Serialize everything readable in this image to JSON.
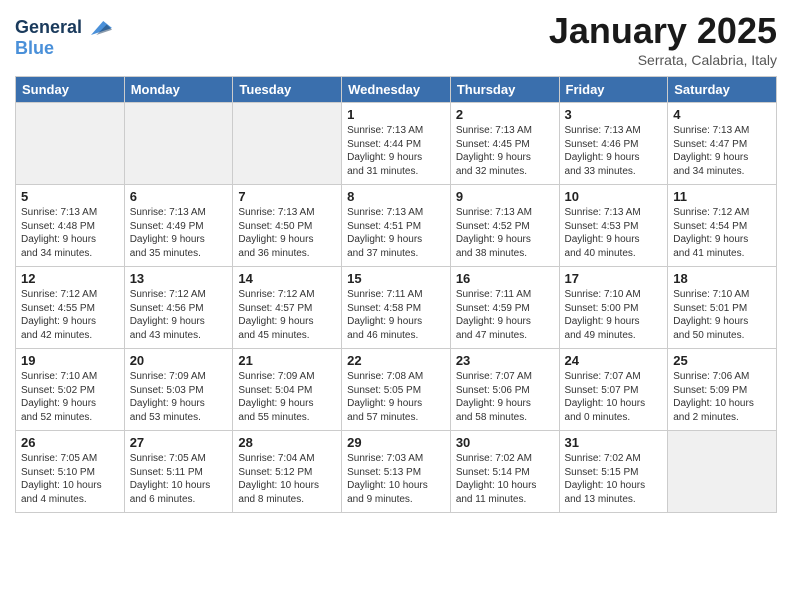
{
  "header": {
    "logo_line1": "General",
    "logo_line2": "Blue",
    "title": "January 2025",
    "location": "Serrata, Calabria, Italy"
  },
  "days_of_week": [
    "Sunday",
    "Monday",
    "Tuesday",
    "Wednesday",
    "Thursday",
    "Friday",
    "Saturday"
  ],
  "weeks": [
    [
      {
        "day": "",
        "detail": ""
      },
      {
        "day": "",
        "detail": ""
      },
      {
        "day": "",
        "detail": ""
      },
      {
        "day": "1",
        "detail": "Sunrise: 7:13 AM\nSunset: 4:44 PM\nDaylight: 9 hours\nand 31 minutes."
      },
      {
        "day": "2",
        "detail": "Sunrise: 7:13 AM\nSunset: 4:45 PM\nDaylight: 9 hours\nand 32 minutes."
      },
      {
        "day": "3",
        "detail": "Sunrise: 7:13 AM\nSunset: 4:46 PM\nDaylight: 9 hours\nand 33 minutes."
      },
      {
        "day": "4",
        "detail": "Sunrise: 7:13 AM\nSunset: 4:47 PM\nDaylight: 9 hours\nand 34 minutes."
      }
    ],
    [
      {
        "day": "5",
        "detail": "Sunrise: 7:13 AM\nSunset: 4:48 PM\nDaylight: 9 hours\nand 34 minutes."
      },
      {
        "day": "6",
        "detail": "Sunrise: 7:13 AM\nSunset: 4:49 PM\nDaylight: 9 hours\nand 35 minutes."
      },
      {
        "day": "7",
        "detail": "Sunrise: 7:13 AM\nSunset: 4:50 PM\nDaylight: 9 hours\nand 36 minutes."
      },
      {
        "day": "8",
        "detail": "Sunrise: 7:13 AM\nSunset: 4:51 PM\nDaylight: 9 hours\nand 37 minutes."
      },
      {
        "day": "9",
        "detail": "Sunrise: 7:13 AM\nSunset: 4:52 PM\nDaylight: 9 hours\nand 38 minutes."
      },
      {
        "day": "10",
        "detail": "Sunrise: 7:13 AM\nSunset: 4:53 PM\nDaylight: 9 hours\nand 40 minutes."
      },
      {
        "day": "11",
        "detail": "Sunrise: 7:12 AM\nSunset: 4:54 PM\nDaylight: 9 hours\nand 41 minutes."
      }
    ],
    [
      {
        "day": "12",
        "detail": "Sunrise: 7:12 AM\nSunset: 4:55 PM\nDaylight: 9 hours\nand 42 minutes."
      },
      {
        "day": "13",
        "detail": "Sunrise: 7:12 AM\nSunset: 4:56 PM\nDaylight: 9 hours\nand 43 minutes."
      },
      {
        "day": "14",
        "detail": "Sunrise: 7:12 AM\nSunset: 4:57 PM\nDaylight: 9 hours\nand 45 minutes."
      },
      {
        "day": "15",
        "detail": "Sunrise: 7:11 AM\nSunset: 4:58 PM\nDaylight: 9 hours\nand 46 minutes."
      },
      {
        "day": "16",
        "detail": "Sunrise: 7:11 AM\nSunset: 4:59 PM\nDaylight: 9 hours\nand 47 minutes."
      },
      {
        "day": "17",
        "detail": "Sunrise: 7:10 AM\nSunset: 5:00 PM\nDaylight: 9 hours\nand 49 minutes."
      },
      {
        "day": "18",
        "detail": "Sunrise: 7:10 AM\nSunset: 5:01 PM\nDaylight: 9 hours\nand 50 minutes."
      }
    ],
    [
      {
        "day": "19",
        "detail": "Sunrise: 7:10 AM\nSunset: 5:02 PM\nDaylight: 9 hours\nand 52 minutes."
      },
      {
        "day": "20",
        "detail": "Sunrise: 7:09 AM\nSunset: 5:03 PM\nDaylight: 9 hours\nand 53 minutes."
      },
      {
        "day": "21",
        "detail": "Sunrise: 7:09 AM\nSunset: 5:04 PM\nDaylight: 9 hours\nand 55 minutes."
      },
      {
        "day": "22",
        "detail": "Sunrise: 7:08 AM\nSunset: 5:05 PM\nDaylight: 9 hours\nand 57 minutes."
      },
      {
        "day": "23",
        "detail": "Sunrise: 7:07 AM\nSunset: 5:06 PM\nDaylight: 9 hours\nand 58 minutes."
      },
      {
        "day": "24",
        "detail": "Sunrise: 7:07 AM\nSunset: 5:07 PM\nDaylight: 10 hours\nand 0 minutes."
      },
      {
        "day": "25",
        "detail": "Sunrise: 7:06 AM\nSunset: 5:09 PM\nDaylight: 10 hours\nand 2 minutes."
      }
    ],
    [
      {
        "day": "26",
        "detail": "Sunrise: 7:05 AM\nSunset: 5:10 PM\nDaylight: 10 hours\nand 4 minutes."
      },
      {
        "day": "27",
        "detail": "Sunrise: 7:05 AM\nSunset: 5:11 PM\nDaylight: 10 hours\nand 6 minutes."
      },
      {
        "day": "28",
        "detail": "Sunrise: 7:04 AM\nSunset: 5:12 PM\nDaylight: 10 hours\nand 8 minutes."
      },
      {
        "day": "29",
        "detail": "Sunrise: 7:03 AM\nSunset: 5:13 PM\nDaylight: 10 hours\nand 9 minutes."
      },
      {
        "day": "30",
        "detail": "Sunrise: 7:02 AM\nSunset: 5:14 PM\nDaylight: 10 hours\nand 11 minutes."
      },
      {
        "day": "31",
        "detail": "Sunrise: 7:02 AM\nSunset: 5:15 PM\nDaylight: 10 hours\nand 13 minutes."
      },
      {
        "day": "",
        "detail": ""
      }
    ]
  ]
}
